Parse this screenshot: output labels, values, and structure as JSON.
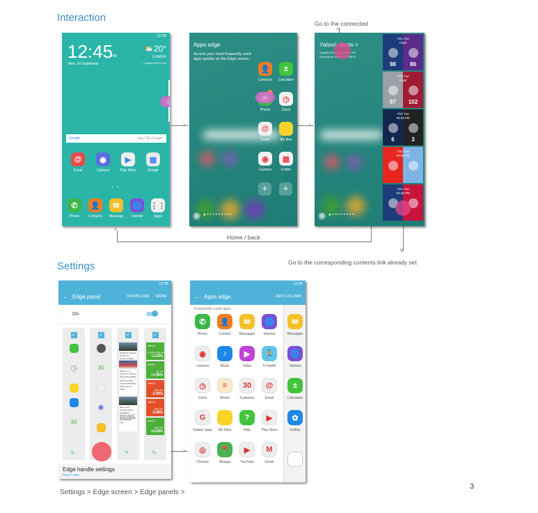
{
  "sections": {
    "interaction": "Interaction",
    "settings": "Settings"
  },
  "annotations": {
    "go_connected": "Go to the connected",
    "home_back": "Home / back",
    "go_contents": "Go to the corresponding contents link already set",
    "breadcrumb": "Settings > Edge screen > Edge panels >",
    "page_number": "3"
  },
  "home_screen": {
    "status_time": "12:45",
    "clock": "12:45",
    "ampm": "PM",
    "date": "Mon, 24 September",
    "temperature": "20°",
    "location": "London",
    "updated": "Updated 24/09 12:45",
    "search_brand": "Google",
    "search_hint": "Say \"Ok Google\"",
    "apps_row1": [
      {
        "label": "Email",
        "color": "#e84a4a",
        "glyph": "@"
      },
      {
        "label": "Camera",
        "color": "#5b6ee0",
        "glyph": "◉"
      },
      {
        "label": "Play Store",
        "color": "#f0f0f0",
        "glyph": "▶"
      },
      {
        "label": "Google",
        "color": "#e9e9e9",
        "glyph": "▦"
      }
    ],
    "dock": [
      {
        "label": "Phone",
        "color": "#3cb64a",
        "glyph": "✆"
      },
      {
        "label": "Contacts",
        "color": "#ef7d22",
        "glyph": "👤"
      },
      {
        "label": "Message",
        "color": "#f6c02b",
        "glyph": "✉"
      },
      {
        "label": "Internet",
        "color": "#7a4fd6",
        "glyph": "🌐"
      },
      {
        "label": "Apps",
        "color": "#f0f0f0",
        "glyph": "⋮⋮"
      }
    ]
  },
  "apps_edge": {
    "title": "Apps edge",
    "description": "Access your most frequently used apps quickly on the Edge screen.",
    "apps": [
      {
        "label": "Contacts",
        "color": "#ef7d22",
        "glyph": "👤"
      },
      {
        "label": "Calculator",
        "color": "#43c43d",
        "glyph": "±"
      },
      {
        "label": "Phone",
        "color": "#3cb64a",
        "glyph": "✆",
        "badge": "2"
      },
      {
        "label": "Clock",
        "color": "#f0f0f0",
        "glyph": "◷"
      },
      {
        "label": "Email",
        "color": "#f0f0f0",
        "glyph": "@"
      },
      {
        "label": "My files",
        "color": "#f8d32a",
        "glyph": ""
      },
      {
        "label": "Camera",
        "color": "#f0f0f0",
        "glyph": "◉"
      },
      {
        "label": "Folder",
        "color": "#f0f0f0",
        "glyph": "▦"
      }
    ],
    "add_label": "+"
  },
  "sports_edge": {
    "title": "Yahoo! sports >",
    "updated": "Updated 2015/10/13 03:17 PM",
    "powered": "Powered by YAHOO! SPORTS",
    "games": [
      {
        "date": "7/21 Tue",
        "status": "Final",
        "home_color": "#1d3c7a",
        "away_color": "#5b2c8c",
        "home_score": "98",
        "away_score": "86"
      },
      {
        "date": "7/21 Tue",
        "status": "Final",
        "home_color": "#9aa0a6",
        "away_color": "#a01c34",
        "home_score": "97",
        "away_score": "102"
      },
      {
        "date": "7/21 Tue",
        "status": "05:35 PM",
        "home_color": "#13264e",
        "away_color": "#222222",
        "home_score": "6",
        "away_score": "3"
      },
      {
        "date": "7/21 Tue",
        "status": "04:00 PM",
        "home_color": "#e8251f",
        "away_color": "#7db4e6",
        "home_score": "",
        "away_score": ""
      },
      {
        "date": "7/21 Tue",
        "status": "05:35 PM",
        "home_color": "#1d3c7a",
        "away_color": "#c8143c",
        "home_score": "",
        "away_score": ""
      }
    ]
  },
  "edge_panel_settings": {
    "status_time": "12:45",
    "title": "Edge panel",
    "download": "DOWNLOAD",
    "more": "MORE",
    "toggle_label": "On",
    "toggle_on": true,
    "stocks": [
      {
        "name": "ABCD",
        "sub": "Company",
        "value": "1,330,000.00",
        "change": "+1.63%",
        "color": "#4caf3a"
      },
      {
        "name": "ABCD",
        "sub": "Company",
        "value": "34.72",
        "change": "+1.56%",
        "color": "#4caf3a"
      },
      {
        "name": "ABCD",
        "sub": "Company",
        "value": "208.35",
        "change": "-2.54%",
        "color": "#e0502a"
      },
      {
        "name": "ABCD",
        "sub": "Company",
        "value": "625.51",
        "change": "-0.48%",
        "color": "#e0502a"
      },
      {
        "name": "ABCD",
        "sub": "Company",
        "value": "168.76",
        "change": "+4.64%",
        "color": "#4caf3a"
      }
    ],
    "news": [
      "Rockstar releases behind the scenes footage from Paris",
      "March is on course to become one of the hottest",
      "Samsung Milk music destination featuring top tracks",
      "New study reveals Cancer caused by lifestyle choices including diet and",
      "Guns, Congress and Murphy's Law"
    ],
    "handle_title": "Edge handle settings",
    "handle_sub": "Right side"
  },
  "apps_edge_settings": {
    "status_time": "12:45",
    "title": "Apps edge",
    "add_column": "ADD COLUMN",
    "section": "Frequently used apps",
    "grid": [
      {
        "label": "Phone",
        "color": "#3cb64a",
        "glyph": "✆"
      },
      {
        "label": "Contact",
        "color": "#ef7d22",
        "glyph": "👤"
      },
      {
        "label": "Messages",
        "color": "#f6c02b",
        "glyph": "✉"
      },
      {
        "label": "Internet",
        "color": "#7a4fd6",
        "glyph": "🌐"
      },
      {
        "label": "Camera",
        "color": "#eeeeee",
        "glyph": "◉"
      },
      {
        "label": "Music",
        "color": "#1e88e5",
        "glyph": "♪"
      },
      {
        "label": "Video",
        "color": "#c042d8",
        "glyph": "▶"
      },
      {
        "label": "S Health",
        "color": "#60c3e8",
        "glyph": "🏃"
      },
      {
        "label": "Clock",
        "color": "#eeeeee",
        "glyph": "◷"
      },
      {
        "label": "Memo",
        "color": "#fbe9c8",
        "glyph": "≡"
      },
      {
        "label": "S planner",
        "color": "#eeeeee",
        "glyph": "30"
      },
      {
        "label": "Email",
        "color": "#eeeeee",
        "glyph": "@"
      },
      {
        "label": "Galaxy apps",
        "color": "#eeeeee",
        "glyph": "G"
      },
      {
        "label": "My Files",
        "color": "#f8d32a",
        "glyph": ""
      },
      {
        "label": "Help",
        "color": "#43c43d",
        "glyph": "?"
      },
      {
        "label": "Play Store",
        "color": "#eeeeee",
        "glyph": "▶"
      },
      {
        "label": "Chrome",
        "color": "#eeeeee",
        "glyph": "◎"
      },
      {
        "label": "Mmaps",
        "color": "#4caf50",
        "glyph": "📍"
      },
      {
        "label": "YouTube",
        "color": "#eeeeee",
        "glyph": "▶"
      },
      {
        "label": "Gmail",
        "color": "#eeeeee",
        "glyph": "M"
      }
    ],
    "edge_column": [
      {
        "label": "Messages",
        "color": "#f6c02b",
        "glyph": "✉"
      },
      {
        "label": "Internet",
        "color": "#7a4fd6",
        "glyph": "🌐"
      },
      {
        "label": "Calculator",
        "color": "#43c43d",
        "glyph": "±"
      },
      {
        "label": "Gallery",
        "color": "#1e88e5",
        "glyph": "✿"
      }
    ]
  }
}
